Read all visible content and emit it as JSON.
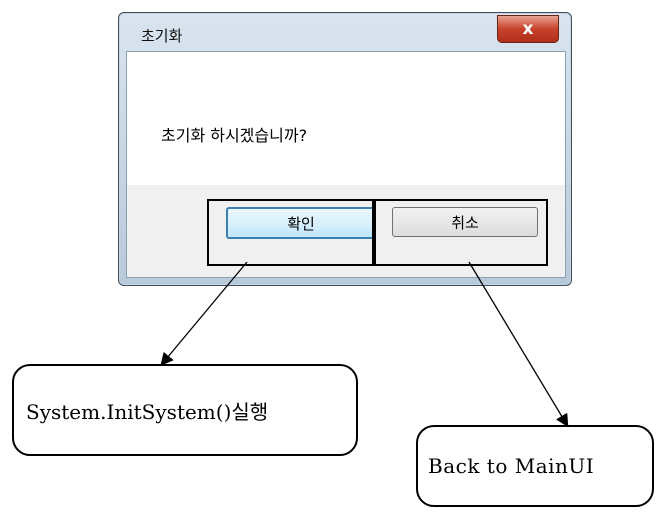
{
  "dialog": {
    "title": "초기화",
    "close_label": "x",
    "message": "초기화 하시겠습니까?",
    "ok_label": "확인",
    "cancel_label": "취소"
  },
  "results": {
    "ok_action": "System.InitSystem()실행",
    "cancel_action": "Back to MainUI"
  }
}
